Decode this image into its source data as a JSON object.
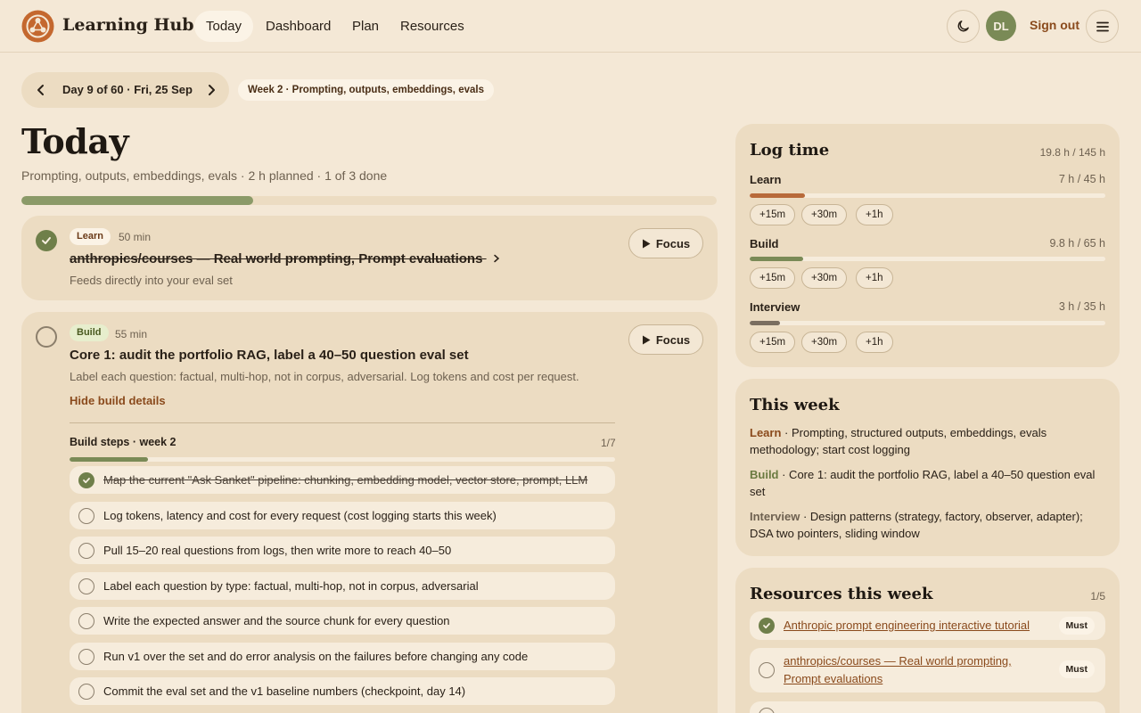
{
  "header": {
    "brand": "Learning Hub",
    "nav": [
      {
        "label": "Today",
        "active": true
      },
      {
        "label": "Dashboard",
        "active": false
      },
      {
        "label": "Plan",
        "active": false
      },
      {
        "label": "Resources",
        "active": false
      }
    ],
    "avatar_initials": "DL",
    "signout_label": "Sign out"
  },
  "day": {
    "label": "Day 9 of 60 · Fri, 25 Sep",
    "week_label": "Week 2 · Prompting, outputs, embeddings, evals"
  },
  "today": {
    "title": "Today",
    "subtitle": "Prompting, outputs, embeddings, evals · 2 h planned · 1 of 3 done",
    "progress": 0.333
  },
  "tasks": [
    {
      "tag": "Learn",
      "duration": "50 min",
      "title": "anthropics/courses — Real world prompting, Prompt evaluations",
      "desc": "Feeds directly into your eval set",
      "done": true,
      "focus_label": "Focus"
    },
    {
      "tag": "Build",
      "duration": "55 min",
      "title": "Core 1: audit the portfolio RAG, label a 40–50 question eval set",
      "desc": "Label each question: factual, multi-hop, not in corpus, adversarial. Log tokens and cost per request.",
      "done": false,
      "focus_label": "Focus",
      "hide_details_label": "Hide build details"
    }
  ],
  "build_steps": {
    "title": "Build steps · week 2",
    "count": "1/7",
    "progress": 0.143,
    "steps": [
      {
        "text": "Map the current \"Ask Sanket\" pipeline: chunking, embedding model, vector store, prompt, LLM",
        "done": true
      },
      {
        "text": "Log tokens, latency and cost for every request (cost logging starts this week)",
        "done": false
      },
      {
        "text": "Pull 15–20 real questions from logs, then write more to reach 40–50",
        "done": false
      },
      {
        "text": "Label each question by type: factual, multi-hop, not in corpus, adversarial",
        "done": false
      },
      {
        "text": "Write the expected answer and the source chunk for every question",
        "done": false
      },
      {
        "text": "Run v1 over the set and do error analysis on the failures before changing any code",
        "done": false
      },
      {
        "text": "Commit the eval set and the v1 baseline numbers (checkpoint, day 14)",
        "done": false
      }
    ]
  },
  "log_time": {
    "title": "Log time",
    "total": "19.8 h / 145 h",
    "rows": [
      {
        "label": "Learn",
        "value": "7 h / 45 h",
        "progress": 0.156,
        "color": "#b86a3a"
      },
      {
        "label": "Build",
        "value": "9.8 h / 65 h",
        "progress": 0.151,
        "color": "#7a8a56"
      },
      {
        "label": "Interview",
        "value": "3 h / 35 h",
        "progress": 0.086,
        "color": "#7a6e60"
      }
    ],
    "buttons": [
      "+15m",
      "+30m",
      "+1h"
    ]
  },
  "this_week": {
    "title": "This week",
    "learn_key": "Learn",
    "learn_text": " · Prompting, structured outputs, embeddings, evals methodology; start cost logging",
    "build_key": "Build",
    "build_text": " · Core 1: audit the portfolio RAG, label a 40–50 question eval set",
    "interview_key": "Interview",
    "interview_text": " · Design patterns (strategy, factory, observer, adapter); DSA two pointers, sliding window"
  },
  "resources": {
    "title": "Resources this week",
    "count": "1/5",
    "items": [
      {
        "label": "Anthropic prompt engineering interactive tutorial",
        "badge": "Must",
        "done": true
      },
      {
        "label": "anthropics/courses — Real world prompting, Prompt evaluations",
        "badge": "Must",
        "done": false
      }
    ]
  }
}
